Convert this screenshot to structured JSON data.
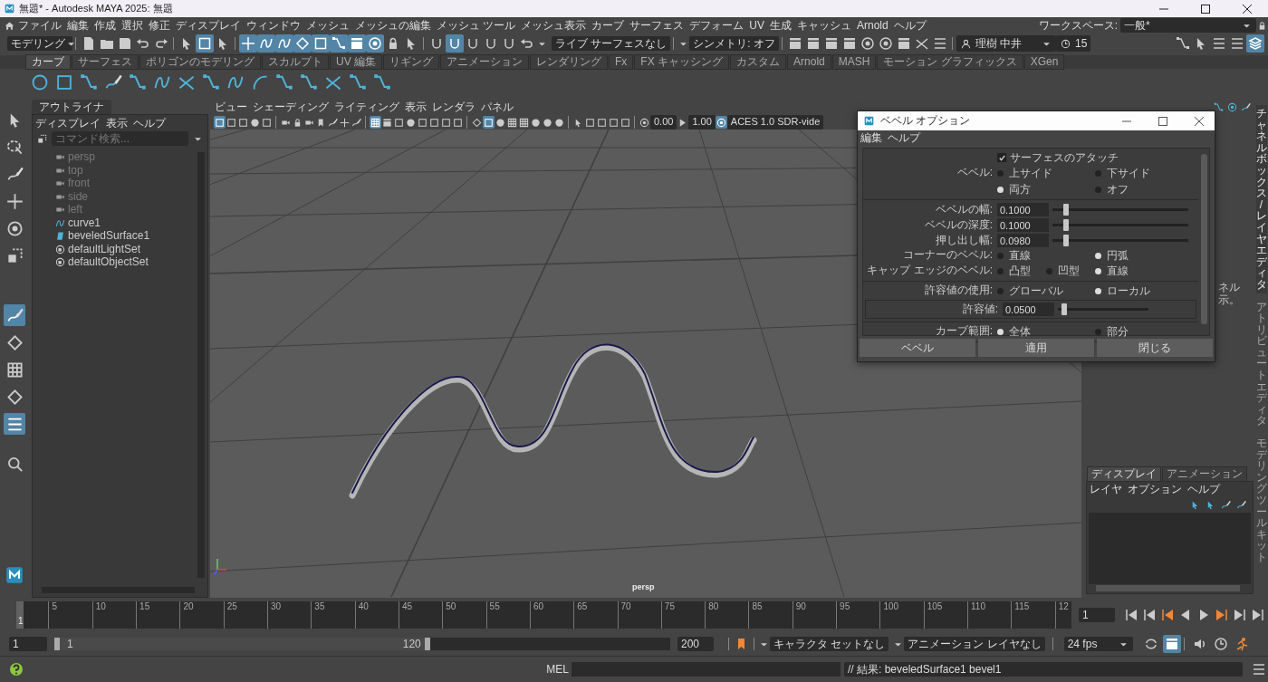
{
  "window": {
    "title": "無題* - Autodesk MAYA 2025: 無題"
  },
  "menu_bar": {
    "items": [
      "ファイル",
      "編集",
      "作成",
      "選択",
      "修正",
      "ディスプレイ",
      "ウィンドウ",
      "メッシュ",
      "メッシュの編集",
      "メッシュ ツール",
      "メッシュ表示",
      "カーブ",
      "サーフェス",
      "デフォーム",
      "UV",
      "生成",
      "キャッシュ",
      "Arnold",
      "ヘルプ"
    ],
    "workspace_label": "ワークスペース:",
    "workspace": "一般*"
  },
  "status_line": {
    "mode": "モデリング",
    "tool_groups": [
      {
        "tools": [
          {
            "selected": false
          },
          {
            "selected": false
          },
          {
            "selected": false
          },
          {
            "selected": false
          },
          {
            "selected": false
          }
        ]
      },
      {
        "tools": [
          {
            "selected": false
          },
          {
            "selected": true
          },
          {
            "selected": false
          }
        ]
      },
      {
        "tools": [
          {
            "selected": true
          },
          {
            "selected": true
          },
          {
            "selected": true
          },
          {
            "selected": true
          },
          {
            "selected": true
          },
          {
            "selected": true
          },
          {
            "selected": true
          },
          {
            "selected": true
          },
          {
            "selected": false
          },
          {
            "selected": false
          }
        ]
      },
      {
        "tools": [
          {
            "selected": false
          },
          {
            "selected": true
          },
          {
            "selected": false
          },
          {
            "selected": false
          },
          {
            "selected": false
          },
          {
            "selected": false
          }
        ]
      }
    ],
    "live_surface": "ライブ サーフェスなし",
    "symmetry": "シンメトリ: オフ",
    "render_tools": [
      {
        "selected": false
      },
      {
        "selected": false
      },
      {
        "selected": false
      },
      {
        "selected": false
      },
      {
        "selected": false
      },
      {
        "selected": false
      },
      {
        "selected": false
      },
      {
        "selected": false
      },
      {
        "selected": false
      }
    ],
    "user": "理樹 中井",
    "credits": "15",
    "panel_toggles": [
      {
        "selected": false
      },
      {
        "selected": false
      },
      {
        "selected": false
      },
      {
        "selected": false
      },
      {
        "selected": true
      }
    ]
  },
  "shelf": {
    "tabs": [
      {
        "label": "カーブ",
        "selected": true
      },
      {
        "label": "サーフェス",
        "selected": false
      },
      {
        "label": "ポリゴンのモデリング",
        "selected": false
      },
      {
        "label": "スカルプト",
        "selected": false
      },
      {
        "label": "UV 編集",
        "selected": false
      },
      {
        "label": "リギング",
        "selected": false
      },
      {
        "label": "アニメーション",
        "selected": false
      },
      {
        "label": "レンダリング",
        "selected": false
      },
      {
        "label": "Fx",
        "selected": false
      },
      {
        "label": "FX キャッシング",
        "selected": false
      },
      {
        "label": "カスタム",
        "selected": false
      },
      {
        "label": "Arnold",
        "selected": false
      },
      {
        "label": "MASH",
        "selected": false
      },
      {
        "label": "モーション グラフィックス",
        "selected": false
      },
      {
        "label": "XGen",
        "selected": false
      }
    ]
  },
  "toolbox": {
    "tools": [
      {
        "selected": false
      },
      {
        "selected": false
      },
      {
        "selected": false
      },
      {
        "selected": false
      },
      {
        "selected": false
      },
      {
        "selected": false
      },
      {
        "selected": true
      },
      {
        "selected": false
      },
      {
        "selected": false
      },
      {
        "selected": false
      },
      {
        "selected": true
      },
      {
        "selected": false
      }
    ]
  },
  "outliner": {
    "tab": "アウトライナ",
    "menu": [
      "ディスプレイ",
      "表示",
      "ヘルプ"
    ],
    "search": {
      "placeholder": "コマンド検索..."
    },
    "items": [
      {
        "label": "persp",
        "kind": "camera",
        "hidden": true
      },
      {
        "label": "top",
        "kind": "camera",
        "hidden": true
      },
      {
        "label": "front",
        "kind": "camera",
        "hidden": true
      },
      {
        "label": "side",
        "kind": "camera",
        "hidden": true
      },
      {
        "label": "left",
        "kind": "camera",
        "hidden": true
      },
      {
        "label": "curve1",
        "kind": "curve",
        "hidden": false
      },
      {
        "label": "beveledSurface1",
        "kind": "surface",
        "hidden": false
      },
      {
        "label": "defaultLightSet",
        "kind": "set",
        "hidden": false
      },
      {
        "label": "defaultObjectSet",
        "kind": "set",
        "hidden": false
      }
    ]
  },
  "viewport": {
    "menu": [
      "ビュー",
      "シェーディング",
      "ライティング",
      "表示",
      "レンダラ",
      "パネル"
    ],
    "tool_groups": [
      {
        "tools": [
          {
            "selected": true
          },
          {
            "selected": false
          },
          {
            "selected": false
          },
          {
            "selected": false
          },
          {
            "selected": false
          }
        ]
      },
      {
        "tools": [
          {
            "selected": false
          },
          {
            "selected": false
          },
          {
            "selected": false
          },
          {
            "selected": false
          },
          {
            "selected": false
          },
          {
            "selected": false
          },
          {
            "selected": false
          }
        ]
      },
      {
        "tools": [
          {
            "selected": true
          },
          {
            "selected": false
          },
          {
            "selected": false
          },
          {
            "selected": false
          },
          {
            "selected": false
          },
          {
            "selected": false
          },
          {
            "selected": false
          },
          {
            "selected": false
          }
        ]
      },
      {
        "tools": [
          {
            "selected": false
          },
          {
            "selected": true
          },
          {
            "selected": false
          },
          {
            "selected": false
          },
          {
            "selected": false
          },
          {
            "selected": false
          },
          {
            "selected": false
          },
          {
            "selected": false
          }
        ]
      },
      {
        "tools": [
          {
            "selected": false
          },
          {
            "selected": false
          },
          {
            "selected": false
          },
          {
            "selected": false
          },
          {
            "selected": false
          }
        ]
      }
    ],
    "exposure": "0.00",
    "gamma": "1.00",
    "color_space": "ACES 1.0 SDR-vide",
    "camera": "persp"
  },
  "bevel_dialog": {
    "title": "ベベル オプション",
    "menu": [
      "編集",
      "ヘルプ"
    ],
    "sections": [
      {
        "rows": [
          {
            "kind": "checkbox",
            "label": "サーフェスのアタッチ",
            "checked": true
          },
          {
            "kind": "radio",
            "label": "ベベル:",
            "options": [
              {
                "label": "上サイド",
                "selected": false
              },
              {
                "label": "下サイド",
                "selected": false
              },
              {
                "label": "両方",
                "selected": true
              },
              {
                "label": "オフ",
                "selected": false
              }
            ]
          }
        ]
      },
      {
        "rows": [
          {
            "kind": "slider",
            "label": "ベベルの幅:",
            "value": "0.1000",
            "level": 0.1
          },
          {
            "kind": "slider",
            "label": "ベベルの深度:",
            "value": "0.1000",
            "level": 0.1
          },
          {
            "kind": "slider",
            "label": "押し出し幅:",
            "value": "0.0980",
            "level": 0.1
          },
          {
            "kind": "radio",
            "label": "コーナーのベベル:",
            "options": [
              {
                "label": "直線",
                "selected": false
              },
              {
                "label": "円弧",
                "selected": true
              }
            ]
          },
          {
            "kind": "radio",
            "label": "キャップ エッジのベベル:",
            "options": [
              {
                "label": "凸型",
                "selected": false
              },
              {
                "label": "凹型",
                "selected": false
              },
              {
                "label": "直線",
                "selected": true
              }
            ]
          }
        ]
      },
      {
        "rows": [
          {
            "kind": "radio",
            "label": "許容値の使用:",
            "options": [
              {
                "label": "グローバル",
                "selected": false
              },
              {
                "label": "ローカル",
                "selected": true
              }
            ]
          },
          {
            "kind": "inset_slider",
            "label": "許容値:",
            "value": "0.0500",
            "level": 0.07
          }
        ]
      },
      {
        "rows": [
          {
            "kind": "radio",
            "label": "カーブ範囲:",
            "options": [
              {
                "label": "全体",
                "selected": true
              },
              {
                "label": "部分",
                "selected": false
              }
            ]
          }
        ]
      }
    ],
    "buttons": [
      "ベベル",
      "適用",
      "閉じる"
    ]
  },
  "side_tabs": [
    {
      "label": "チャネルボックス/レイヤエディタ",
      "selected": true
    },
    {
      "label": "アトリビュートエディタ",
      "selected": false
    },
    {
      "label": "モデリングツールキット",
      "selected": false
    }
  ],
  "channel_box": {
    "lines": [
      "ネル",
      "示。"
    ]
  },
  "layer_editor": {
    "tabs": [
      {
        "label": "ディスプレイ",
        "selected": true
      },
      {
        "label": "アニメーション",
        "selected": false
      }
    ],
    "menu": [
      "レイヤ",
      "オプション",
      "ヘルプ"
    ]
  },
  "time_slider": {
    "ticks": [
      "5",
      "10",
      "15",
      "20",
      "25",
      "30",
      "35",
      "40",
      "45",
      "50",
      "55",
      "60",
      "65",
      "70",
      "75",
      "80",
      "85",
      "90",
      "95",
      "100",
      "105",
      "110",
      "115",
      "12"
    ],
    "current_frame": "1",
    "frame_field": "1"
  },
  "range_slider": {
    "start": "1",
    "range_start": "1",
    "range_end": "120",
    "end": "200",
    "level": 0.61,
    "character_set": "キャラクタ セットなし",
    "anim_layer": "アニメーション レイヤなし",
    "fps": "24 fps",
    "tools": [
      {
        "selected": false
      },
      {
        "selected": true
      },
      {
        "selected": false
      },
      {
        "selected": false
      },
      {
        "selected": false
      }
    ]
  },
  "command_line": {
    "language": "MEL",
    "result": "// 結果: beveledSurface1 bevel1"
  }
}
